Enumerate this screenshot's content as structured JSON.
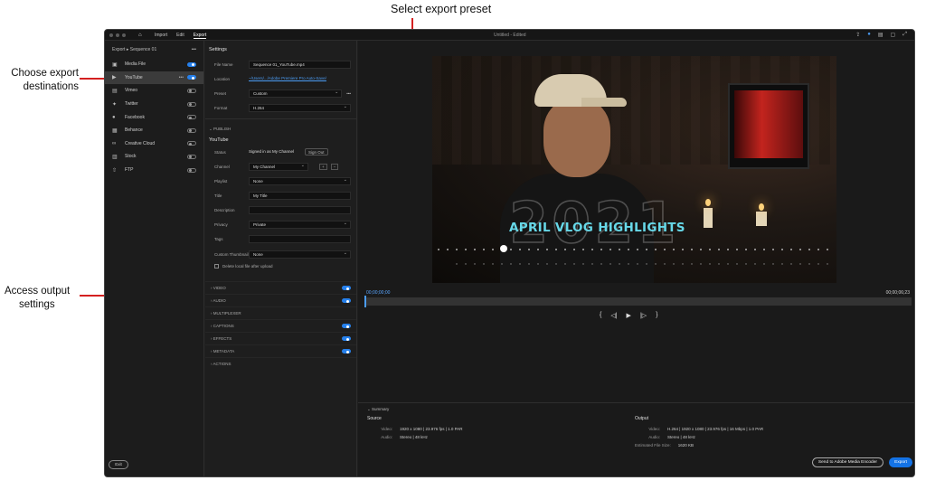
{
  "callouts": {
    "preset": "Select export preset",
    "destinations_line1": "Choose export",
    "destinations_line2": "destinations",
    "output_line1": "Access output",
    "output_line2": "settings"
  },
  "topbar": {
    "tabs": [
      "Import",
      "Edit",
      "Export"
    ],
    "active_tab": "Export",
    "window_title": "Untitled - Edited"
  },
  "left_panel": {
    "header": "Export",
    "sequence": "Sequence 01",
    "more": "•••",
    "destinations": [
      {
        "label": "Media File",
        "icon": "film-icon",
        "enabled": true
      },
      {
        "label": "YouTube",
        "icon": "youtube-icon",
        "enabled": true,
        "selected": true
      },
      {
        "label": "Vimeo",
        "icon": "vimeo-icon",
        "enabled": false
      },
      {
        "label": "Twitter",
        "icon": "twitter-icon",
        "enabled": false
      },
      {
        "label": "Facebook",
        "icon": "facebook-icon",
        "enabled": false
      },
      {
        "label": "Behance",
        "icon": "behance-icon",
        "enabled": false
      },
      {
        "label": "Creative Cloud",
        "icon": "creative-cloud-icon",
        "enabled": false
      },
      {
        "label": "Stock",
        "icon": "stock-icon",
        "enabled": false
      },
      {
        "label": "FTP",
        "icon": "ftp-icon",
        "enabled": false
      }
    ],
    "exit_label": "Exit"
  },
  "settings": {
    "title": "Settings",
    "file_name_label": "File Name",
    "file_name": "Sequence 01_YouTube.mp4",
    "location_label": "Location",
    "location": "~/Users/.../Adobe Premiere Pro Auto-Save/",
    "preset_label": "Preset",
    "preset": "Custom",
    "format_label": "Format",
    "format": "H.264",
    "publish_header": "PUBLISH",
    "youtube_title": "YouTube",
    "status_label": "Status",
    "status": "Signed in as My Channel",
    "sign_out": "Sign Out",
    "channel_label": "Channel",
    "channel": "My Channel",
    "playlist_label": "Playlist",
    "playlist": "None",
    "title_label": "Title",
    "title_value": "My Title",
    "description_label": "Description",
    "privacy_label": "Privacy",
    "privacy": "Private",
    "tags_label": "Tags",
    "thumbnail_label": "Custom Thumbnail",
    "thumbnail": "None",
    "delete_local": "Delete local file after upload",
    "sections": [
      {
        "label": "VIDEO",
        "toggle": true
      },
      {
        "label": "AUDIO",
        "toggle": true
      },
      {
        "label": "MULTIPLEXER",
        "toggle": false
      },
      {
        "label": "CAPTIONS",
        "toggle": true
      },
      {
        "label": "EFFECTS",
        "toggle": true
      },
      {
        "label": "METADATA",
        "toggle": true
      },
      {
        "label": "ACTIONS",
        "toggle": false
      }
    ]
  },
  "preview": {
    "year": "2021",
    "video_title": "APRIL VLOG HIGHLIGHTS",
    "timecode_start": "00;00;00;00",
    "timecode_end": "00;00;06;23"
  },
  "summary": {
    "header": "Summary",
    "source_title": "Source",
    "source_video_label": "Video:",
    "source_video": "1920 x 1080  |  23.976 fps  |  1.0 PAR",
    "source_audio_label": "Audio:",
    "source_audio": "Stereo  |  48 kHz",
    "output_title": "Output",
    "output_video_label": "Video:",
    "output_video": "H.264  |  1920 x 1080  |  23.976 fps  |  16 Mbps  |  1.0 PAR",
    "output_audio_label": "Audio:",
    "output_audio": "Stereo  |  48 kHz",
    "size_label": "Estimated File Size:",
    "size": "1620 KB"
  },
  "buttons": {
    "ame": "Send to Adobe Media Encoder",
    "export": "Export"
  }
}
